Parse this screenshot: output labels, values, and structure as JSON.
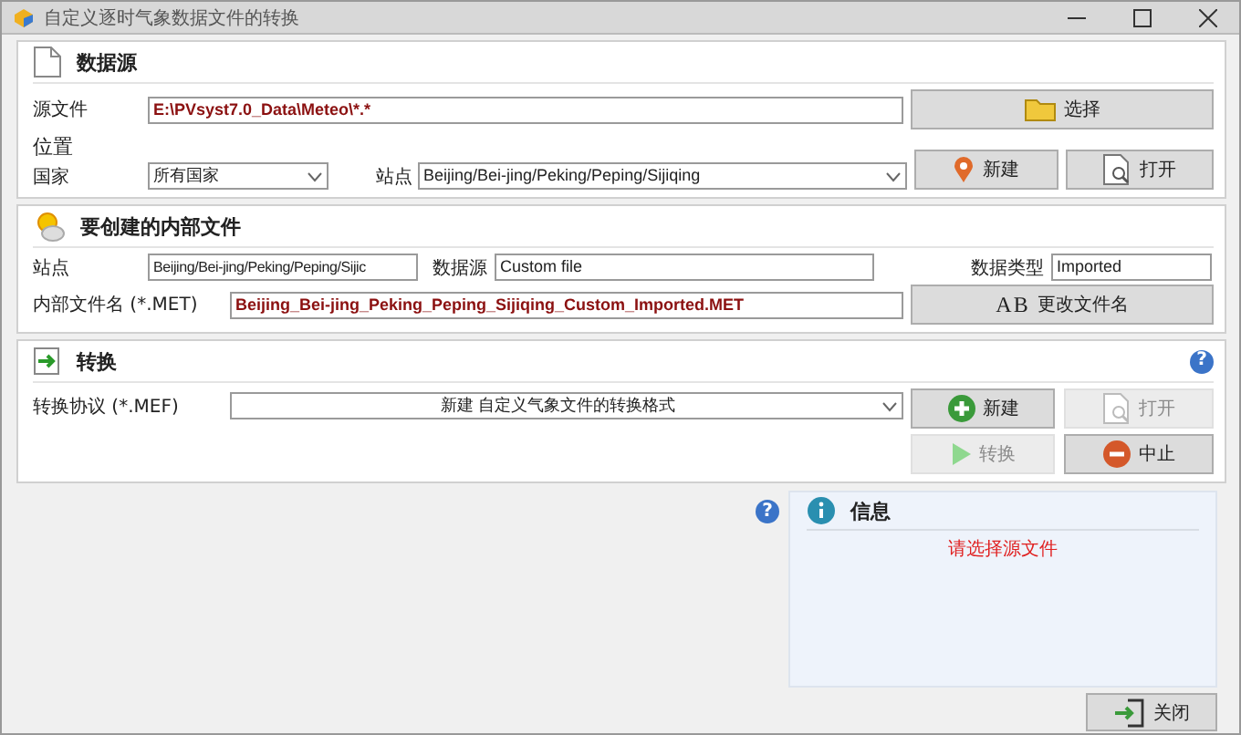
{
  "window": {
    "title": "自定义逐时气象数据文件的转换"
  },
  "source": {
    "title": "数据源",
    "file_label": "源文件",
    "file_value": "E:\\PVsyst7.0_Data\\Meteo\\*.*",
    "choose_button": "选择",
    "location_label": "位置",
    "country_label": "国家",
    "country_value": "所有国家",
    "site_label": "站点",
    "site_value": "Beijing/Bei-jing/Peking/Peping/Sijiqing",
    "new_button": "新建",
    "open_button": "打开"
  },
  "internal": {
    "title": "要创建的内部文件",
    "site_label": "站点",
    "site_value": "Beijing/Bei-jing/Peking/Peping/Sijic",
    "source_label": "数据源",
    "source_value": "Custom file",
    "type_label": "数据类型",
    "type_value": "Imported",
    "filename_label": "内部文件名 (*.MET)",
    "filename_value": "Beijing_Bei-jing_Peking_Peping_Sijiqing_Custom_Imported.MET",
    "rename_icon": "AB",
    "rename_button": "更改文件名"
  },
  "convert": {
    "title": "转换",
    "help": "?",
    "protocol_label": "转换协议 (*.MEF)",
    "protocol_value": "新建 自定义气象文件的转换格式",
    "buttons": [
      {
        "label": "新建",
        "kind": "new",
        "disabled": false
      },
      {
        "label": "打开",
        "kind": "open",
        "disabled": true
      },
      {
        "label": "转换",
        "kind": "convert",
        "disabled": true
      },
      {
        "label": "中止",
        "kind": "abort",
        "disabled": false
      }
    ]
  },
  "info": {
    "help": "?",
    "title": "信息",
    "message": "请选择源文件"
  },
  "close_button": "关闭"
}
